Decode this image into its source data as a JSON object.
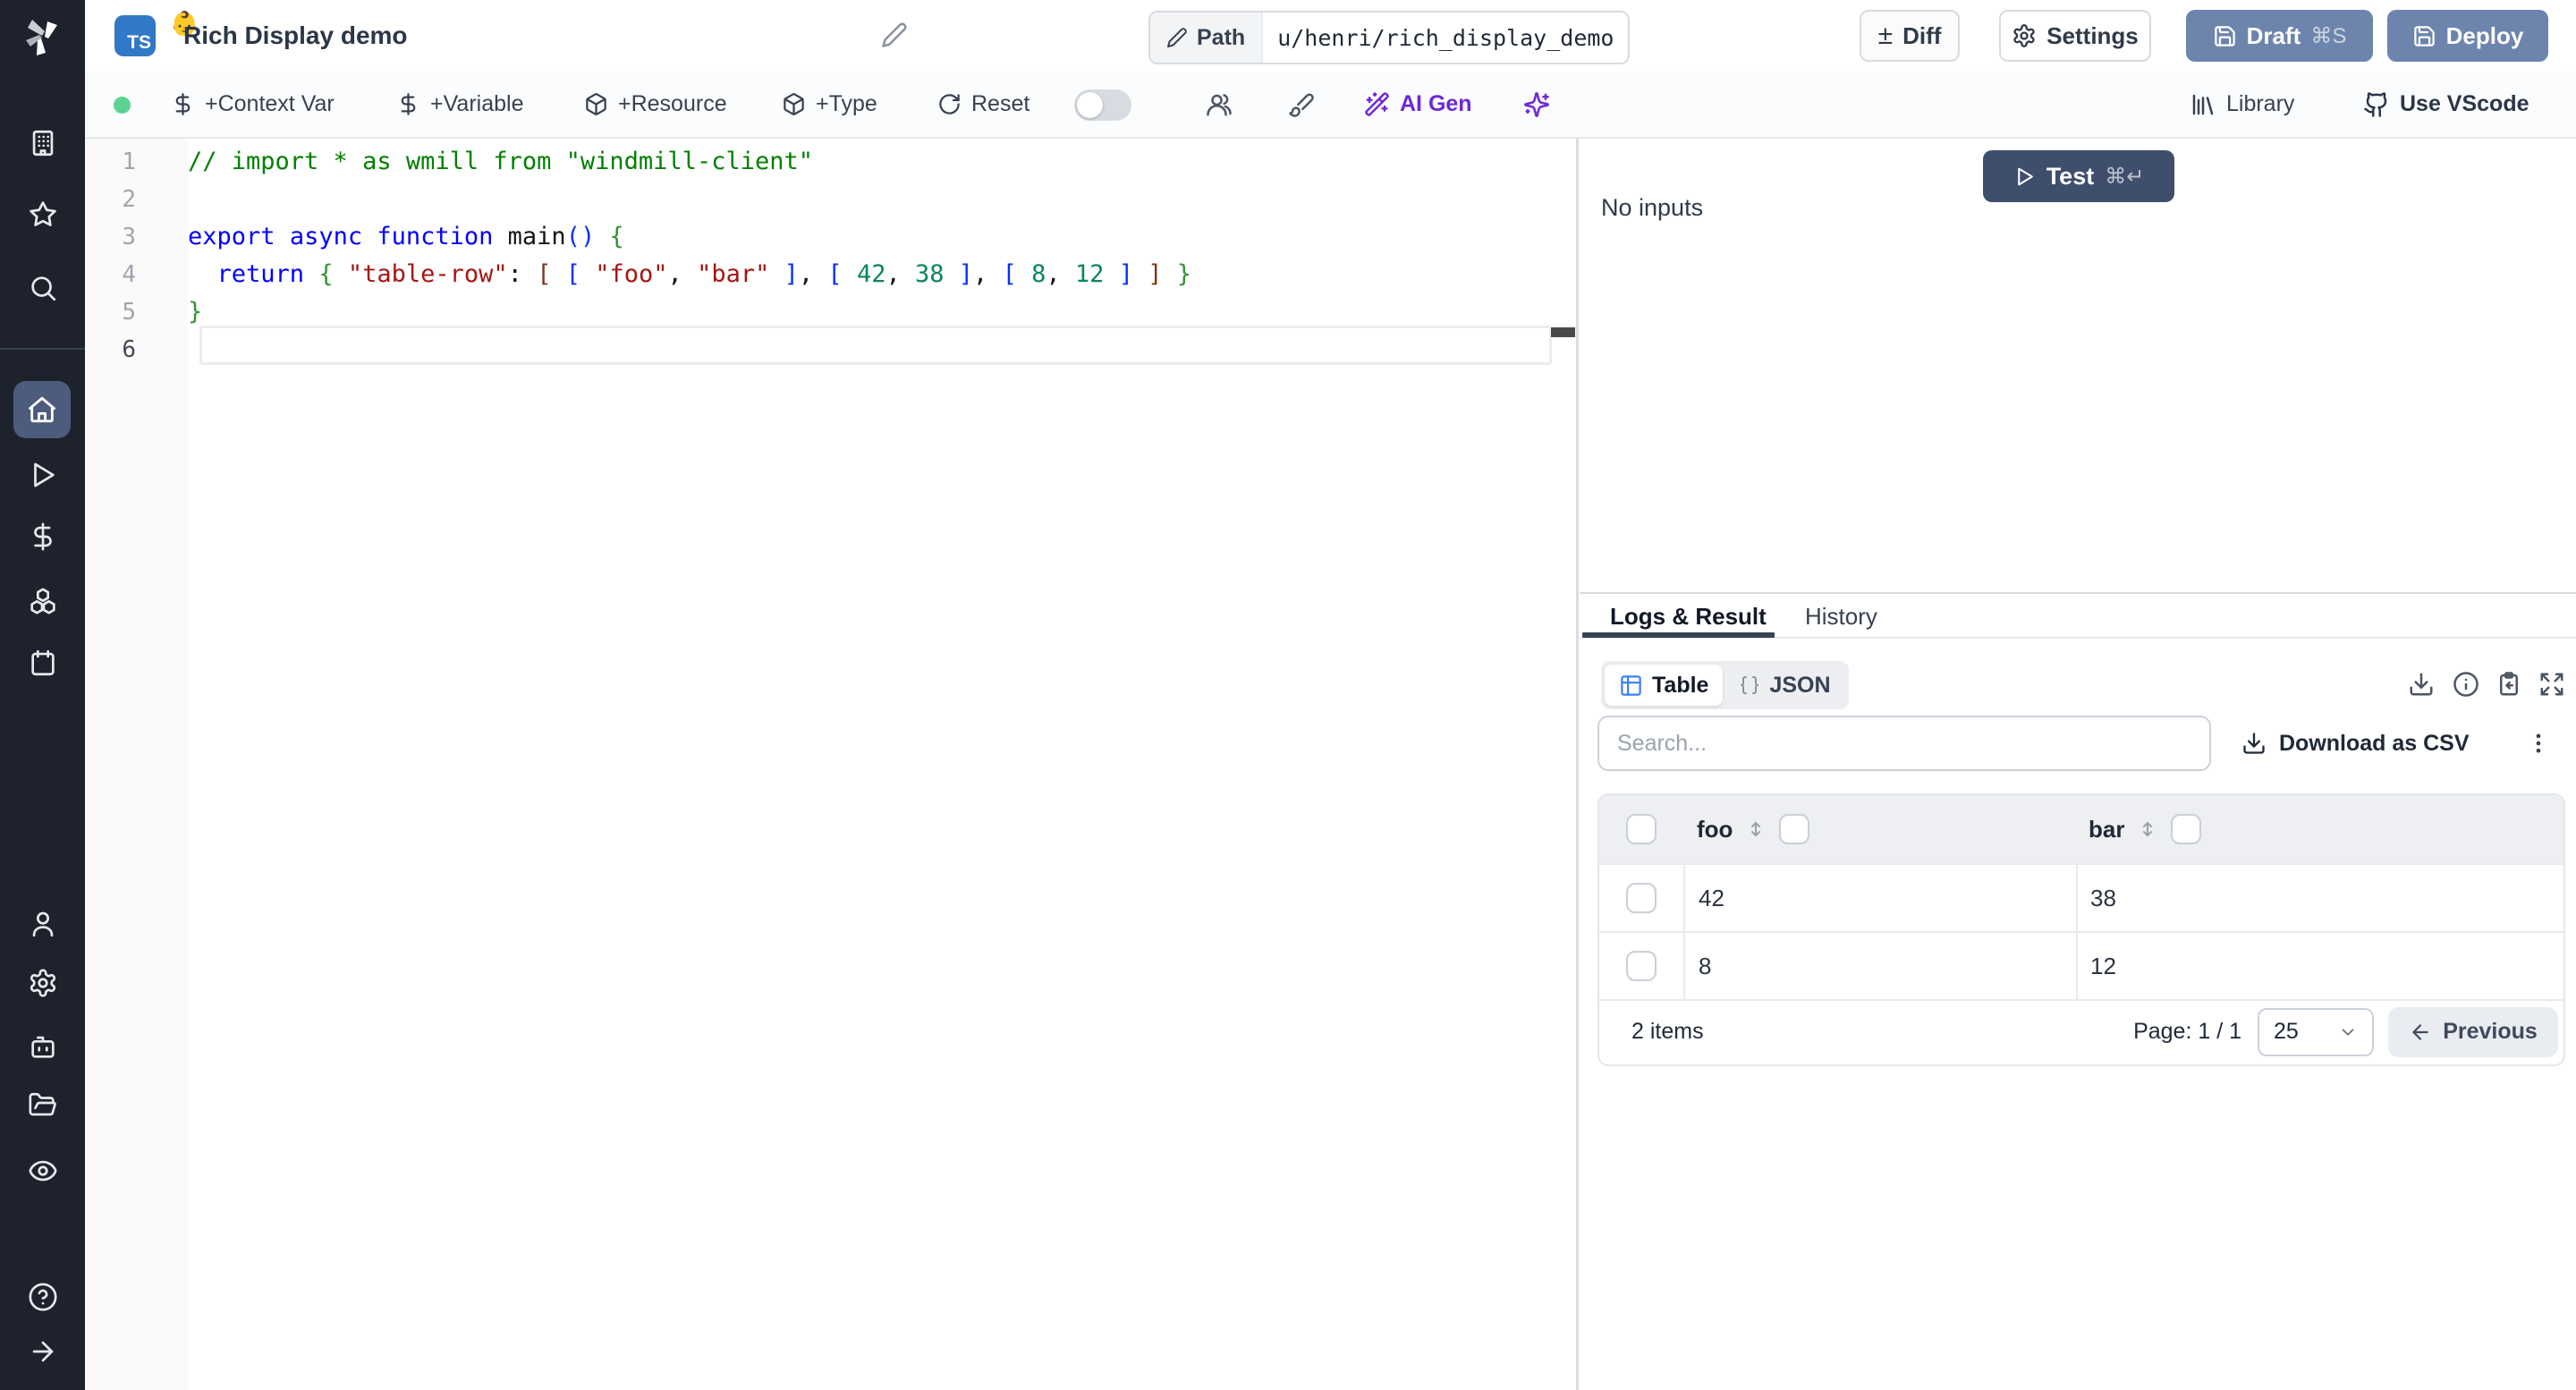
{
  "topbar": {
    "title": "Rich Display demo",
    "language_badge": "TS",
    "badge_emoji": "👶",
    "path_label": "Path",
    "path_value": "u/henri/rich_display_demo",
    "diff_glyph": "±",
    "diff_label": "Diff",
    "settings_label": "Settings",
    "draft_label": "Draft",
    "draft_shortcut": "⌘S",
    "deploy_label": "Deploy"
  },
  "toolbar": {
    "context_var_label": "+Context Var",
    "variable_label": "+Variable",
    "resource_label": "+Resource",
    "type_label": "+Type",
    "reset_label": "Reset",
    "ai_gen_label": "AI Gen",
    "library_label": "Library",
    "vscode_label": "Use VScode"
  },
  "sidebar": {
    "icons": [
      "windmill-logo",
      "workspace-building",
      "favorites-star",
      "search",
      "home",
      "runs-play",
      "variables-dollar",
      "resources-cubes",
      "schedules-calendar",
      "user",
      "settings-gear",
      "workers-bot",
      "folders",
      "audit-eye",
      "help",
      "expand-arrow"
    ]
  },
  "editor": {
    "lines": [
      {
        "num": "1",
        "tokens": [
          {
            "t": "// import * as wmill from \"windmill-client\"",
            "c": "cmt"
          }
        ]
      },
      {
        "num": "2",
        "tokens": []
      },
      {
        "num": "3",
        "tokens": [
          {
            "t": "export",
            "c": "kw"
          },
          {
            "t": " ",
            "c": "pl"
          },
          {
            "t": "async",
            "c": "kw"
          },
          {
            "t": " ",
            "c": "pl"
          },
          {
            "t": "function",
            "c": "kw"
          },
          {
            "t": " main",
            "c": "pl"
          },
          {
            "t": "(",
            "c": "bl"
          },
          {
            "t": ")",
            "c": "bl"
          },
          {
            "t": " ",
            "c": "pl"
          },
          {
            "t": "{",
            "c": "bg"
          }
        ]
      },
      {
        "num": "4",
        "tokens": [
          {
            "t": "  ",
            "c": "pl"
          },
          {
            "t": "return",
            "c": "kw"
          },
          {
            "t": " ",
            "c": "pl"
          },
          {
            "t": "{",
            "c": "bg"
          },
          {
            "t": " ",
            "c": "pl"
          },
          {
            "t": "\"table-row\"",
            "c": "str"
          },
          {
            "t": ":",
            "c": "pl"
          },
          {
            "t": " ",
            "c": "pl"
          },
          {
            "t": "[",
            "c": "bb"
          },
          {
            "t": " ",
            "c": "pl"
          },
          {
            "t": "[",
            "c": "bl"
          },
          {
            "t": " ",
            "c": "pl"
          },
          {
            "t": "\"foo\"",
            "c": "str"
          },
          {
            "t": ",",
            "c": "pl"
          },
          {
            "t": " ",
            "c": "pl"
          },
          {
            "t": "\"bar\"",
            "c": "str"
          },
          {
            "t": " ",
            "c": "pl"
          },
          {
            "t": "]",
            "c": "bl"
          },
          {
            "t": ",",
            "c": "pl"
          },
          {
            "t": " ",
            "c": "pl"
          },
          {
            "t": "[",
            "c": "bl"
          },
          {
            "t": " ",
            "c": "pl"
          },
          {
            "t": "42",
            "c": "num"
          },
          {
            "t": ",",
            "c": "pl"
          },
          {
            "t": " ",
            "c": "pl"
          },
          {
            "t": "38",
            "c": "num"
          },
          {
            "t": " ",
            "c": "pl"
          },
          {
            "t": "]",
            "c": "bl"
          },
          {
            "t": ",",
            "c": "pl"
          },
          {
            "t": " ",
            "c": "pl"
          },
          {
            "t": "[",
            "c": "bl"
          },
          {
            "t": " ",
            "c": "pl"
          },
          {
            "t": "8",
            "c": "num"
          },
          {
            "t": ",",
            "c": "pl"
          },
          {
            "t": " ",
            "c": "pl"
          },
          {
            "t": "12",
            "c": "num"
          },
          {
            "t": " ",
            "c": "pl"
          },
          {
            "t": "]",
            "c": "bl"
          },
          {
            "t": " ",
            "c": "pl"
          },
          {
            "t": "]",
            "c": "bb"
          },
          {
            "t": " ",
            "c": "pl"
          },
          {
            "t": "}",
            "c": "bg"
          }
        ]
      },
      {
        "num": "5",
        "tokens": [
          {
            "t": "}",
            "c": "bg"
          }
        ]
      },
      {
        "num": "6",
        "tokens": []
      }
    ]
  },
  "run_panel": {
    "test_label": "Test",
    "test_shortcut": "⌘↵",
    "no_inputs": "No inputs"
  },
  "results": {
    "tabs": [
      {
        "label": "Logs & Result",
        "active": true
      },
      {
        "label": "History",
        "active": false
      }
    ],
    "view_table_label": "Table",
    "view_json_label": "JSON",
    "search_placeholder": "Search...",
    "download_csv_label": "Download as CSV",
    "table": {
      "columns": [
        "foo",
        "bar"
      ],
      "rows": [
        {
          "foo": "42",
          "bar": "38"
        },
        {
          "foo": "8",
          "bar": "12"
        }
      ]
    },
    "footer": {
      "items_text": "2 items",
      "page_text": "Page: 1 / 1",
      "page_size": "25",
      "previous_label": "Previous"
    }
  },
  "colors": {
    "accent_slate": "#6d85ad",
    "dark_button": "#3f4e6d",
    "sidebar_bg": "#1e222c",
    "sidebar_active": "#4d5c7d",
    "ai_purple": "#6d28d9",
    "table_icon_blue": "#3b82f6",
    "status_green": "#5cd390",
    "ts_blue": "#3178c6"
  }
}
